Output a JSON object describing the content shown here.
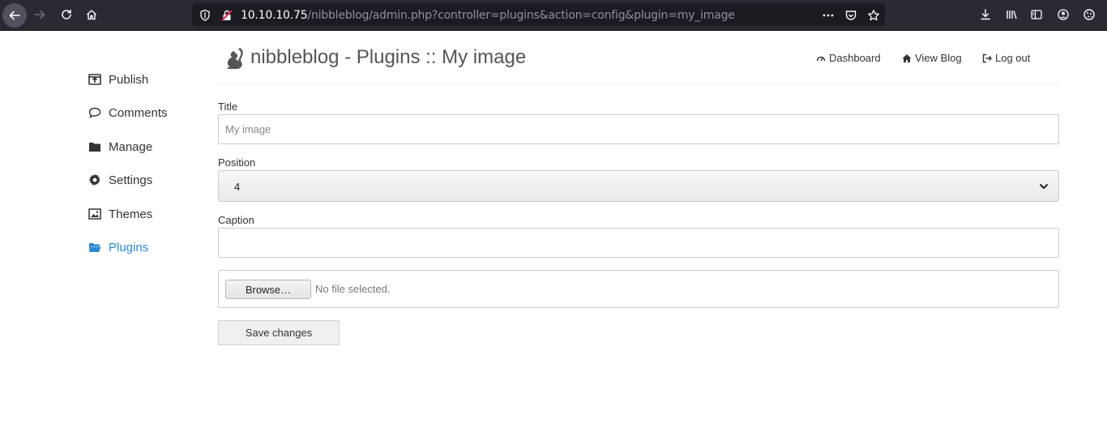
{
  "browser": {
    "url_host": "10.10.10.75",
    "url_path": "/nibbleblog/admin.php?controller=plugins&action=config&plugin=my_image"
  },
  "sidebar": {
    "items": [
      {
        "label": "Publish",
        "icon": "publish-icon"
      },
      {
        "label": "Comments",
        "icon": "comment-icon"
      },
      {
        "label": "Manage",
        "icon": "folder-icon"
      },
      {
        "label": "Settings",
        "icon": "gear-icon"
      },
      {
        "label": "Themes",
        "icon": "image-icon"
      },
      {
        "label": "Plugins",
        "icon": "folder-open-icon",
        "active": true
      }
    ],
    "active_color": "#2a8ad4"
  },
  "header": {
    "title": "nibbleblog - Plugins :: My image",
    "links": {
      "dashboard": "Dashboard",
      "view_blog": "View Blog",
      "logout": "Log out"
    }
  },
  "form": {
    "title_label": "Title",
    "title_placeholder": "My image",
    "title_value": "",
    "position_label": "Position",
    "position_value": "4",
    "caption_label": "Caption",
    "caption_value": "",
    "browse_label": "Browse…",
    "file_status": "No file selected.",
    "save_label": "Save changes"
  }
}
